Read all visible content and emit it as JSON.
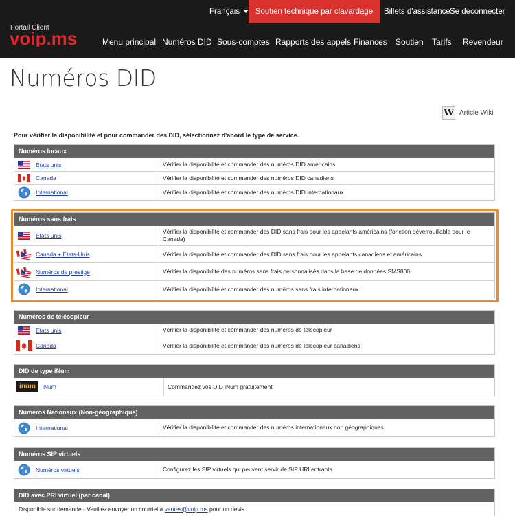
{
  "header": {
    "language": "Français",
    "support": "Soutien technique par clavardage",
    "tickets": "Billets d'assistance",
    "logout": "Se déconnecter",
    "portal": "Portail Client",
    "logo_text": "voip.ms",
    "nav": [
      "Menu principal",
      "Numéros DID",
      "Sous-comptes",
      "Rapports des appels",
      "Finances",
      "Soutien",
      "Tarifs",
      "Revendeur"
    ],
    "colors": {
      "bar": "#1a1a1a",
      "support_bg": "#d9322e",
      "highlight": "#f08a2a"
    }
  },
  "page": {
    "title": "Numéros DID",
    "wiki_icon": "W",
    "wiki_label": "Article Wiki",
    "intro": "Pour vérifier la disponibilité et pour commander des DID, sélectionnez d'abord le type de service."
  },
  "sections": [
    {
      "title": "Numéros locaux",
      "rows": [
        {
          "icon": "us-flag-icon",
          "link": "États unis",
          "desc": "Vérifier la disponibilité et commander des numéros DID américains"
        },
        {
          "icon": "canada-flag-icon",
          "link": "Canada",
          "desc": "Vérifier la disponibilité et commander des numéros DID canadiens"
        },
        {
          "icon": "globe-icon",
          "link": "International",
          "desc": "Vérifier la disponibilité et commander des numéros DID internationaux"
        }
      ]
    },
    {
      "title": "Numéros sans frais",
      "rows": [
        {
          "icon": "us-flag-icon",
          "link": "États unis",
          "desc": "Vérifier la disponibilité et commander des DID sans frais pour les appelants américains (fonction déverrouillable pour le Canada)"
        },
        {
          "icon": "us-canada-flags-icon",
          "link": "Canada + États-Unis",
          "desc": "Vérifier la disponibilité et commander des DID sans frais pour les appelants canadiens et américains"
        },
        {
          "icon": "us-canada-flags-icon",
          "link": "Numéros de prestige",
          "desc": "Vérifier la disponibilité des numéros sans frais personnalisés dans la base de données SMS800"
        },
        {
          "icon": "globe-icon",
          "link": "International",
          "desc": "Vérifier la disponibilité et commander des numéros sans frais internationaux"
        }
      ]
    },
    {
      "title": "Numéros de télécopieur",
      "rows": [
        {
          "icon": "us-flag-icon",
          "link": "États unis",
          "desc": "Vérifier la disponibilité et commander des numéros de télécopieur"
        },
        {
          "icon": "canada-flag-icon",
          "link": "Canada",
          "desc": "Vérifier la disponibilité et commander des numéros de télécopieur canadiens"
        }
      ]
    },
    {
      "title": "DID de type iNum",
      "rows": [
        {
          "icon": "inum-logo-icon",
          "link": "iNum",
          "desc": "Commandez vos DID iNum gratuitement"
        }
      ]
    },
    {
      "title": "Numéros Nationaux (Non-géographique)",
      "rows": [
        {
          "icon": "globe-icon",
          "link": "International",
          "desc": "Vérifier la disponibilité et commander des numéros internationaux non géographiques"
        }
      ]
    },
    {
      "title": "Numéros SIP virtuels",
      "rows": [
        {
          "icon": "globe-icon",
          "link": "Numéros virtuels",
          "desc": "Configurez les SIP virtuels qui peuvent servir de SIP URI entrants"
        }
      ]
    },
    {
      "title": "DID avec PRI virtuel (par canal)",
      "note_before": "Disponible sur demande - Veuillez envoyer un courriel à",
      "email": "ventes@voip.ms",
      "note_after": "pour un devis"
    }
  ],
  "inum_label": "inum"
}
